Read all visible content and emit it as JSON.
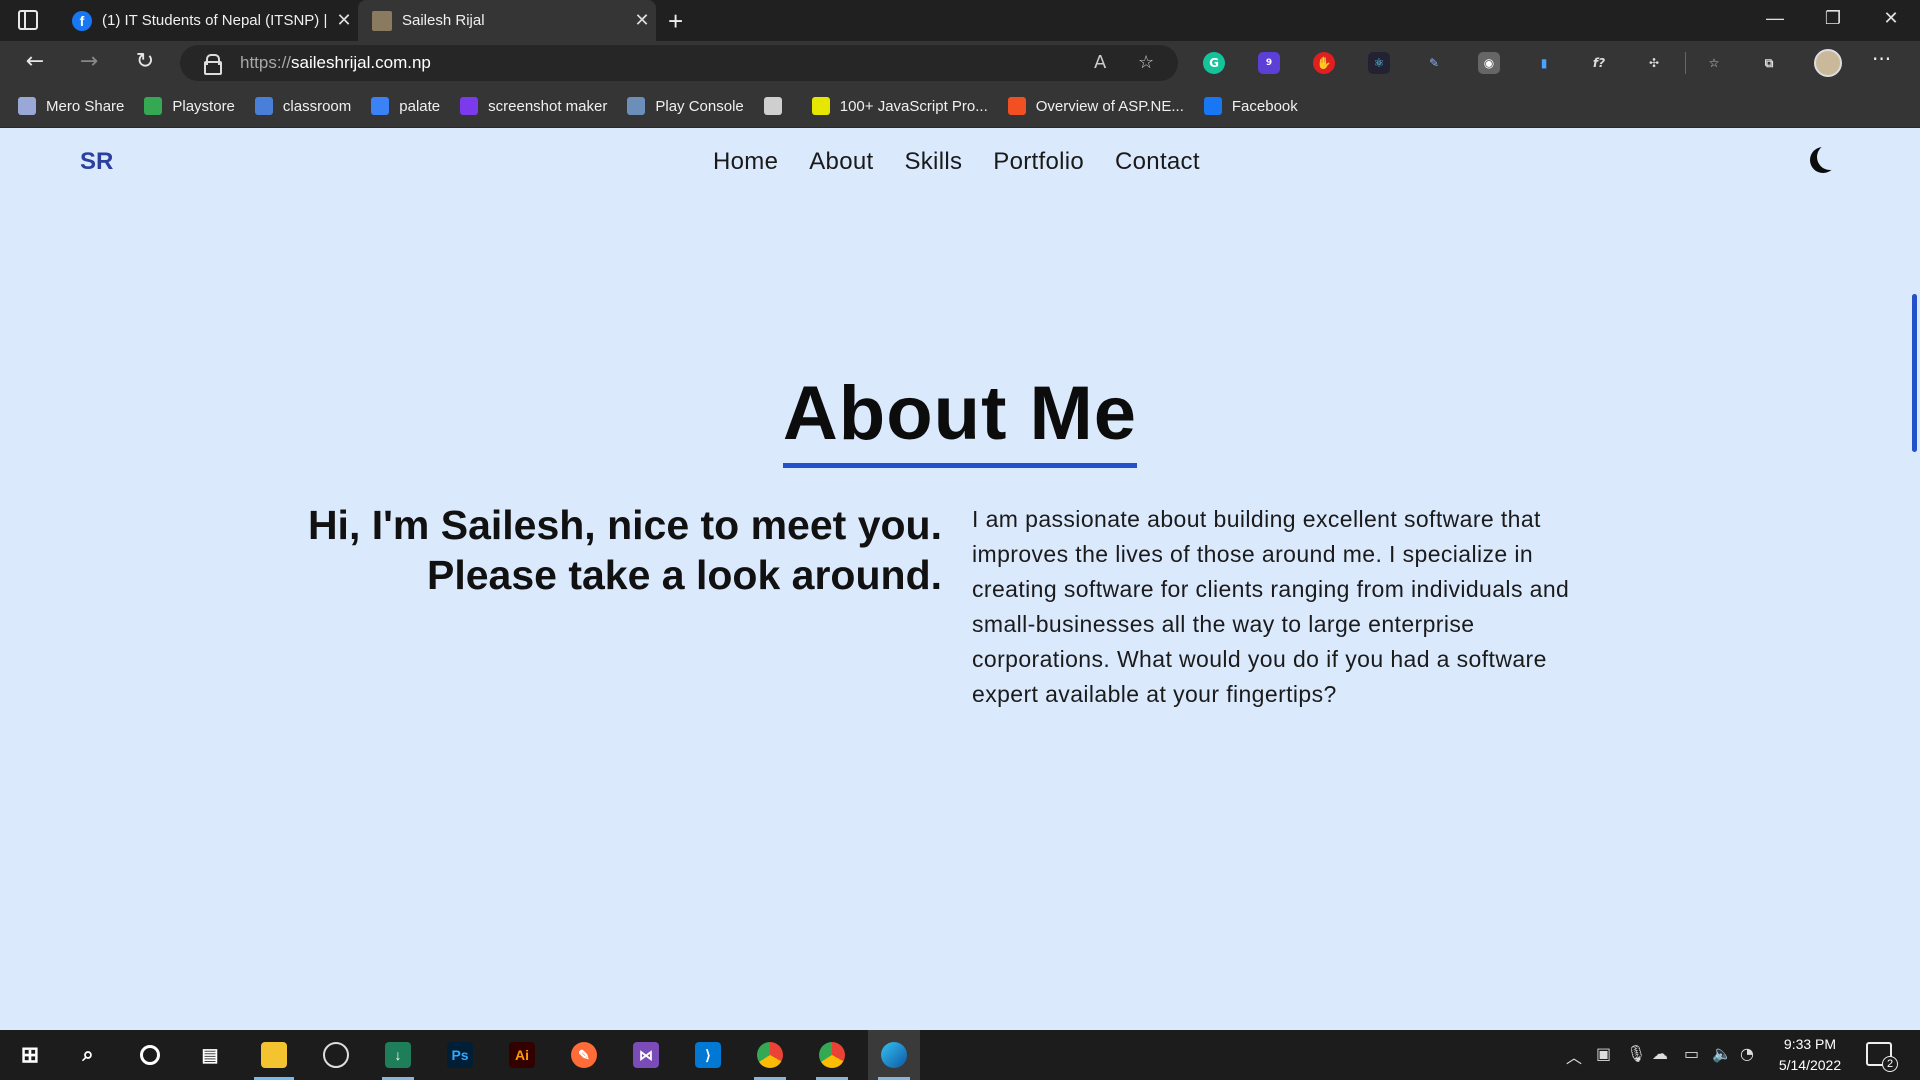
{
  "browser": {
    "tabs": [
      {
        "title": "(1) IT Students of Nepal (ITSNP) |",
        "favicon": "facebook-icon",
        "active": false
      },
      {
        "title": "Sailesh Rijal",
        "favicon": "profile-photo-icon",
        "active": true
      }
    ],
    "url_protocol": "https://",
    "url_host": "saileshrijal.com.np",
    "bookmarks": [
      {
        "label": "Mero Share",
        "icon": "mero-share-icon",
        "color": "#9aa8d8"
      },
      {
        "label": "Playstore",
        "icon": "playstore-icon",
        "color": "#34a853"
      },
      {
        "label": "classroom",
        "icon": "classroom-icon",
        "color": "#4a7fd9"
      },
      {
        "label": "palate",
        "icon": "palate-icon",
        "color": "#3b82f6"
      },
      {
        "label": "screenshot maker",
        "icon": "screenshot-maker-icon",
        "color": "#7c3aed"
      },
      {
        "label": "Play Console",
        "icon": "play-console-icon",
        "color": "#6b8fb8"
      },
      {
        "label": "",
        "icon": "file-icon",
        "color": "#cfcfcf"
      },
      {
        "label": "100+ JavaScript Pro...",
        "icon": "javascript-icon",
        "color": "#e6e600"
      },
      {
        "label": "Overview of ASP.NE...",
        "icon": "microsoft-icon",
        "color": "#f25022"
      },
      {
        "label": "Facebook",
        "icon": "facebook-icon",
        "color": "#1877f2"
      }
    ]
  },
  "site": {
    "logo": "SR",
    "nav": [
      "Home",
      "About",
      "Skills",
      "Portfolio",
      "Contact"
    ],
    "theme_toggle_icon": "moon-icon",
    "section_title": "About Me",
    "intro": "Hi, I'm Sailesh, nice to meet you. Please take a look around.",
    "description": "I am passionate about building excellent software that improves the lives of those around me. I specialize in creating software for clients ranging from individuals and small-businesses all the way to large enterprise corporations. What would you do if you had a software expert available at your fingertips?",
    "accent_color": "#2450c8",
    "background_color": "#dbe9fd"
  },
  "taskbar": {
    "time": "9:33 PM",
    "date": "5/14/2022",
    "notification_count": "2",
    "apps": [
      "start-icon",
      "search-icon",
      "cortana-icon",
      "task-view-icon",
      "file-explorer-icon",
      "obs-icon",
      "installer-icon",
      "photoshop-icon",
      "illustrator-icon",
      "postman-icon",
      "visual-studio-icon",
      "vscode-icon",
      "chrome-icon",
      "chrome-profile-icon",
      "edge-icon"
    ],
    "app_labels": {
      "photoshop": "Ps",
      "illustrator": "Ai"
    }
  },
  "extensions": {
    "badge_count": "9"
  }
}
